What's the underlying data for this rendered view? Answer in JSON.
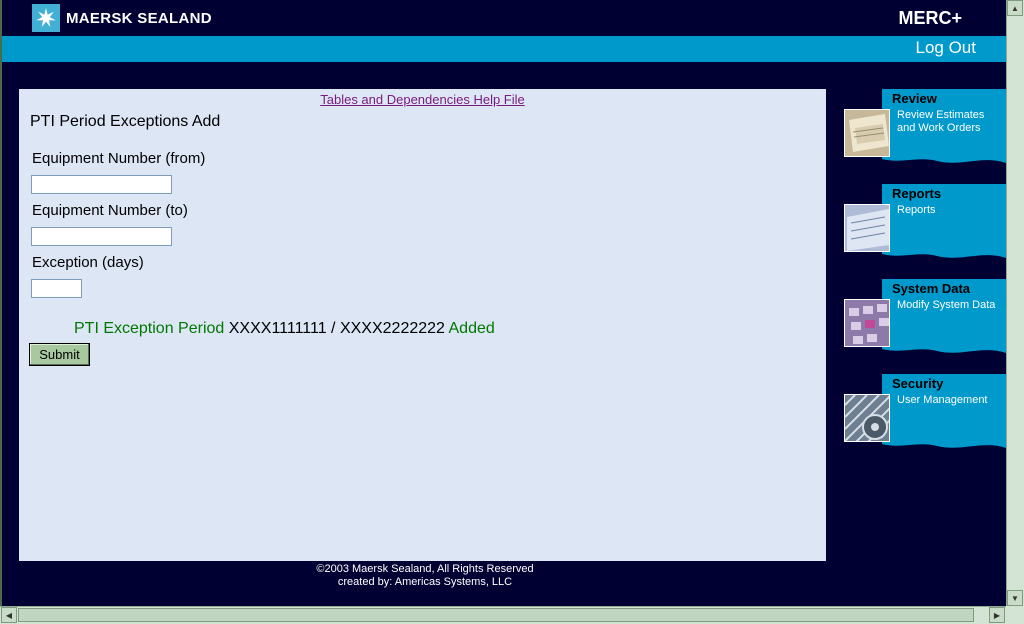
{
  "header": {
    "brand": "MAERSK SEALAND",
    "app_name": "MERC+",
    "logout_label": "Log Out"
  },
  "main": {
    "help_link": "Tables and Dependencies Help File",
    "title": "PTI Period Exceptions Add",
    "fields": {
      "from_label": "Equipment Number (from)",
      "from_value": "",
      "to_label": "Equipment Number (to)",
      "to_value": "",
      "days_label": "Exception (days)",
      "days_value": ""
    },
    "message": {
      "prefix": "PTI Exception Period ",
      "from": "XXXX1111111",
      "sep": " / ",
      "to": "XXXX2222222",
      "suffix": " Added"
    },
    "submit_label": "Submit"
  },
  "footer": {
    "line1": "©2003 Maersk Sealand, All Rights Reserved",
    "line2": "created by: Americas Systems, LLC"
  },
  "sidebar": {
    "items": [
      {
        "title": "Review",
        "link": "Review Estimates and Work Orders"
      },
      {
        "title": "Reports",
        "link": "Reports"
      },
      {
        "title": "System Data",
        "link": "Modify System Data"
      },
      {
        "title": "Security",
        "link": "User Management"
      }
    ]
  },
  "colors": {
    "background": "#000033",
    "accent": "#0099cc",
    "panel": "#dde6f5",
    "message_green": "#007700",
    "help_link": "#7a1a7a"
  }
}
